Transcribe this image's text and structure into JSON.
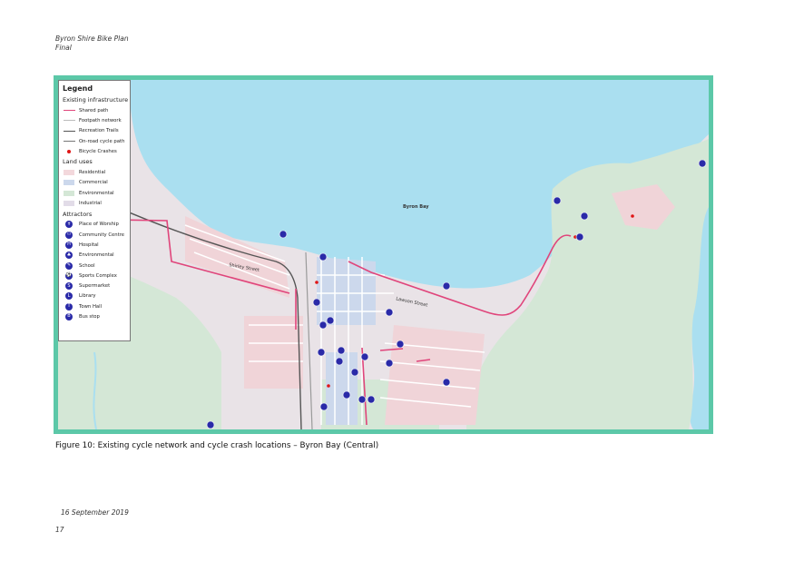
{
  "header": {
    "line1": "Byron Shire Bike Plan",
    "line2": "Final"
  },
  "map": {
    "place_labels": [
      "Byron Bay",
      "Shirley Street",
      "Lawson Street"
    ],
    "colors": {
      "sea": "#aadff0",
      "land": "#e9e3e7",
      "environmental": "#d4e7d6",
      "residential": "#f0d4d8",
      "commercial": "#ccd8ec",
      "shared_path": "#e0457b",
      "crash": "#e01515",
      "icon": "#2a2aa8",
      "frame": "#5cc8a8"
    }
  },
  "legend": {
    "title": "Legend",
    "sections": [
      {
        "title": "Existing infrastructure",
        "items": [
          {
            "label": "Shared path",
            "kind": "line",
            "color": "#e0457b"
          },
          {
            "label": "Footpath network",
            "kind": "line",
            "color": "#bbbbbb"
          },
          {
            "label": "Recreation Trails",
            "kind": "line",
            "color": "#555555"
          },
          {
            "label": "On-road cycle path",
            "kind": "line",
            "color": "#777777"
          },
          {
            "label": "Bicycle Crashes",
            "kind": "dot",
            "color": "#e01515"
          }
        ]
      },
      {
        "title": "Land uses",
        "items": [
          {
            "label": "Residential",
            "kind": "swatch",
            "color": "#f3d8dc"
          },
          {
            "label": "Commercial",
            "kind": "swatch",
            "color": "#ccd8ec"
          },
          {
            "label": "Environmental",
            "kind": "swatch",
            "color": "#d4e7d6"
          },
          {
            "label": "Industrial",
            "kind": "swatch",
            "color": "#e2dce8"
          }
        ]
      },
      {
        "title": "Attractors",
        "items": [
          {
            "label": "Place of Worship",
            "kind": "icon",
            "icon": "worship-icon",
            "glyph": "✝"
          },
          {
            "label": "Community Centre",
            "kind": "icon",
            "icon": "community-centre-icon",
            "glyph": "⚇"
          },
          {
            "label": "Hospital",
            "kind": "icon",
            "icon": "hospital-icon",
            "glyph": "H"
          },
          {
            "label": "Environmental",
            "kind": "icon",
            "icon": "environmental-icon",
            "glyph": "♣"
          },
          {
            "label": "School",
            "kind": "icon",
            "icon": "school-icon",
            "glyph": "✎"
          },
          {
            "label": "Sports Complex",
            "kind": "icon",
            "icon": "sports-complex-icon",
            "glyph": "⚽"
          },
          {
            "label": "Supermarket",
            "kind": "icon",
            "icon": "supermarket-icon",
            "glyph": "S"
          },
          {
            "label": "Library",
            "kind": "icon",
            "icon": "library-icon",
            "glyph": "L"
          },
          {
            "label": "Town Hall",
            "kind": "icon",
            "icon": "town-hall-icon",
            "glyph": "T"
          },
          {
            "label": "Bus stop",
            "kind": "icon",
            "icon": "bus-stop-icon",
            "glyph": "B"
          }
        ]
      }
    ]
  },
  "caption": "Figure 10: Existing cycle network and cycle crash locations – Byron Bay (Central)",
  "footer": {
    "date": "16 September 2019",
    "page": "17"
  }
}
